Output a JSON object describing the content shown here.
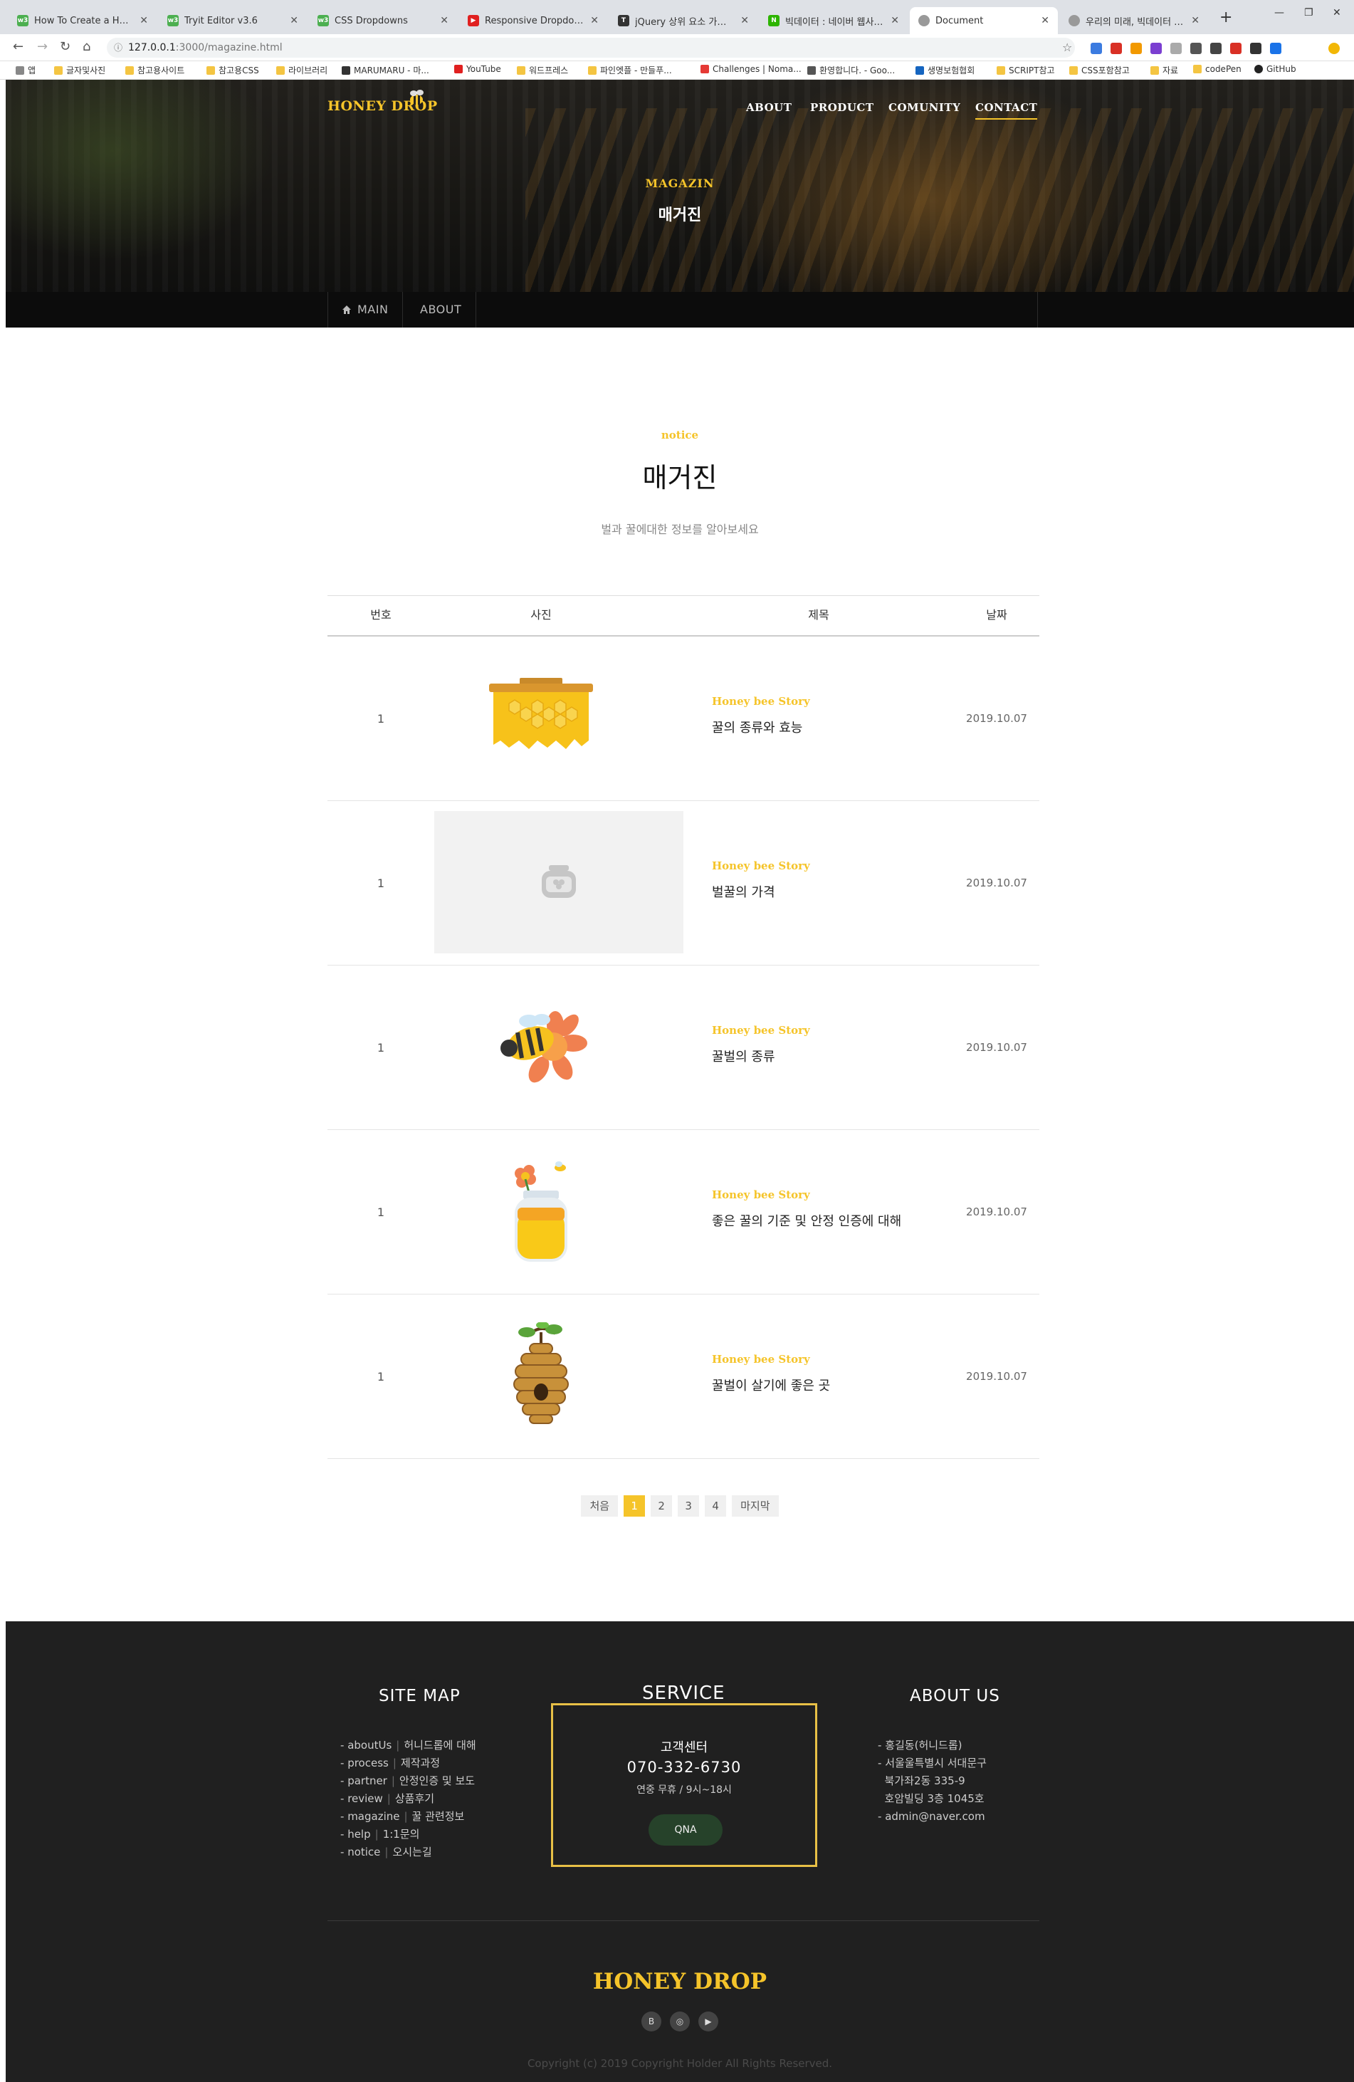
{
  "browser": {
    "tabs": [
      {
        "title": "How To Create a Horizontal",
        "favicon": "w3-icon"
      },
      {
        "title": "Tryit Editor v3.6",
        "favicon": "w3-icon"
      },
      {
        "title": "CSS Dropdowns",
        "favicon": "w3-icon"
      },
      {
        "title": "Responsive Dropdown Nav",
        "favicon": "youtube-icon"
      },
      {
        "title": "jQuery 상위 요소 가져오기",
        "favicon": "tistory-icon"
      },
      {
        "title": "빅데이터 : 네이버 웹사이트",
        "favicon": "naver-icon"
      },
      {
        "title": "Document",
        "favicon": "globe-icon"
      },
      {
        "title": "우리의 미래, 빅데이터 - 틈",
        "favicon": "globe-icon"
      }
    ],
    "address": {
      "host": "127.0.0.1",
      "path": ":3000/magazine.html"
    },
    "bookmarks": [
      "앱",
      "글자및사진",
      "참고용사이트",
      "참고용CSS",
      "라이브러리",
      "MARUMARU - 마...",
      "YouTube",
      "워드프레스",
      "파인엣플 - 만들푸...",
      "Challenges | Noma...",
      "환영합니다. - Goo...",
      "생명보험협회",
      "SCRIPT참고",
      "CSS포함참고",
      "자료",
      "codePen",
      "GitHub"
    ]
  },
  "site": {
    "logo": "HONEY DROP",
    "nav": [
      "ABOUT",
      "PRODUCT",
      "COMUNITY",
      "CONTACT"
    ],
    "hero": {
      "en": "MAGAZIN",
      "ko": "매거진"
    },
    "breadcrumb": [
      "MAIN",
      "ABOUT"
    ],
    "section": {
      "en": "notice",
      "ko": "매거진",
      "sub": "벌과 꿀에대한 정보를 알아보세요"
    },
    "table": {
      "headers": [
        "번호",
        "사진",
        "제목",
        "날짜"
      ],
      "rows": [
        {
          "no": "1",
          "image": "honeycomb-icon",
          "category": "Honey bee Story",
          "title": "꿀의 종류와 효능",
          "date": "2019.10.07"
        },
        {
          "no": "1",
          "image": "honey-jar-placeholder-icon",
          "category": "Honey bee Story",
          "title": "벌꿀의 가격",
          "date": "2019.10.07"
        },
        {
          "no": "1",
          "image": "bee-on-flower-icon",
          "category": "Honey bee Story",
          "title": "꿀벌의 종류",
          "date": "2019.10.07"
        },
        {
          "no": "1",
          "image": "honey-jar-icon",
          "category": "Honey bee Story",
          "title": "좋은 꿀의 기준 및 안정 인증에 대해",
          "date": "2019.10.07"
        },
        {
          "no": "1",
          "image": "beehive-icon",
          "category": "Honey bee Story",
          "title": "꿀벌이 살기에 좋은 곳",
          "date": "2019.10.07"
        }
      ]
    },
    "pagination": {
      "first": "처음",
      "pages": [
        "1",
        "2",
        "3",
        "4"
      ],
      "current": "1",
      "last": "마지막"
    },
    "footer": {
      "sitemap_title": "SITE MAP",
      "sitemap": [
        {
          "en": "aboutUs",
          "ko": "허니드롭에 대해"
        },
        {
          "en": "process",
          "ko": "제작과정"
        },
        {
          "en": "partner",
          "ko": "안정인증 및 보도"
        },
        {
          "en": "review",
          "ko": "상품후기"
        },
        {
          "en": "magazine",
          "ko": "꿀 관련정보"
        },
        {
          "en": "help",
          "ko": "1:1문의"
        },
        {
          "en": "notice",
          "ko": "오시는길"
        }
      ],
      "service_title": "SERVICE",
      "service": {
        "center": "고객센터",
        "phone": "070-332-6730",
        "hours": "연중 무휴 / 9시~18시",
        "button": "QNA"
      },
      "about_title": "ABOUT US",
      "about": [
        "홍길동(허니드롭)",
        "서울울특별시 서대문구",
        "북가좌2동 335-9",
        "호암빌딩 3층 1045호",
        "admin@naver.com"
      ],
      "logo": "HONEY DROP",
      "social": [
        "blog-icon",
        "instagram-icon",
        "youtube-icon"
      ],
      "copyright": "Copyright (c) 2019 Copyright Holder All Rights Reserved."
    }
  },
  "colors": {
    "accent": "#f5c42a",
    "footer_bg": "#202020",
    "qna_bg": "#26422a"
  }
}
